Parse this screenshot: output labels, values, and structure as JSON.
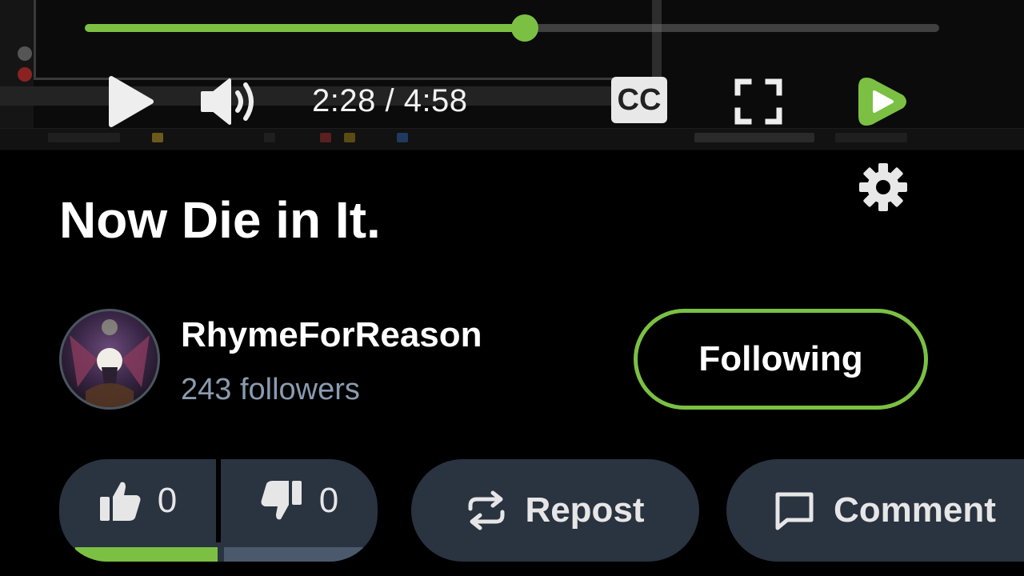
{
  "player": {
    "progress_fraction": 0.515,
    "time_display": "2:28 / 4:58",
    "cc_label": "CC",
    "accent_color": "#7bc043",
    "controls": [
      "play-icon",
      "volume-icon",
      "cc-button",
      "fullscreen-icon",
      "rumble-logo-icon",
      "gear-icon"
    ]
  },
  "video": {
    "title": "Now Die in It."
  },
  "channel": {
    "name": "RhymeForReason",
    "followers": "243 followers",
    "follow_label": "Following"
  },
  "actions": {
    "likes": "0",
    "dislikes": "0",
    "repost_label": "Repost",
    "comment_label": "Comment"
  }
}
